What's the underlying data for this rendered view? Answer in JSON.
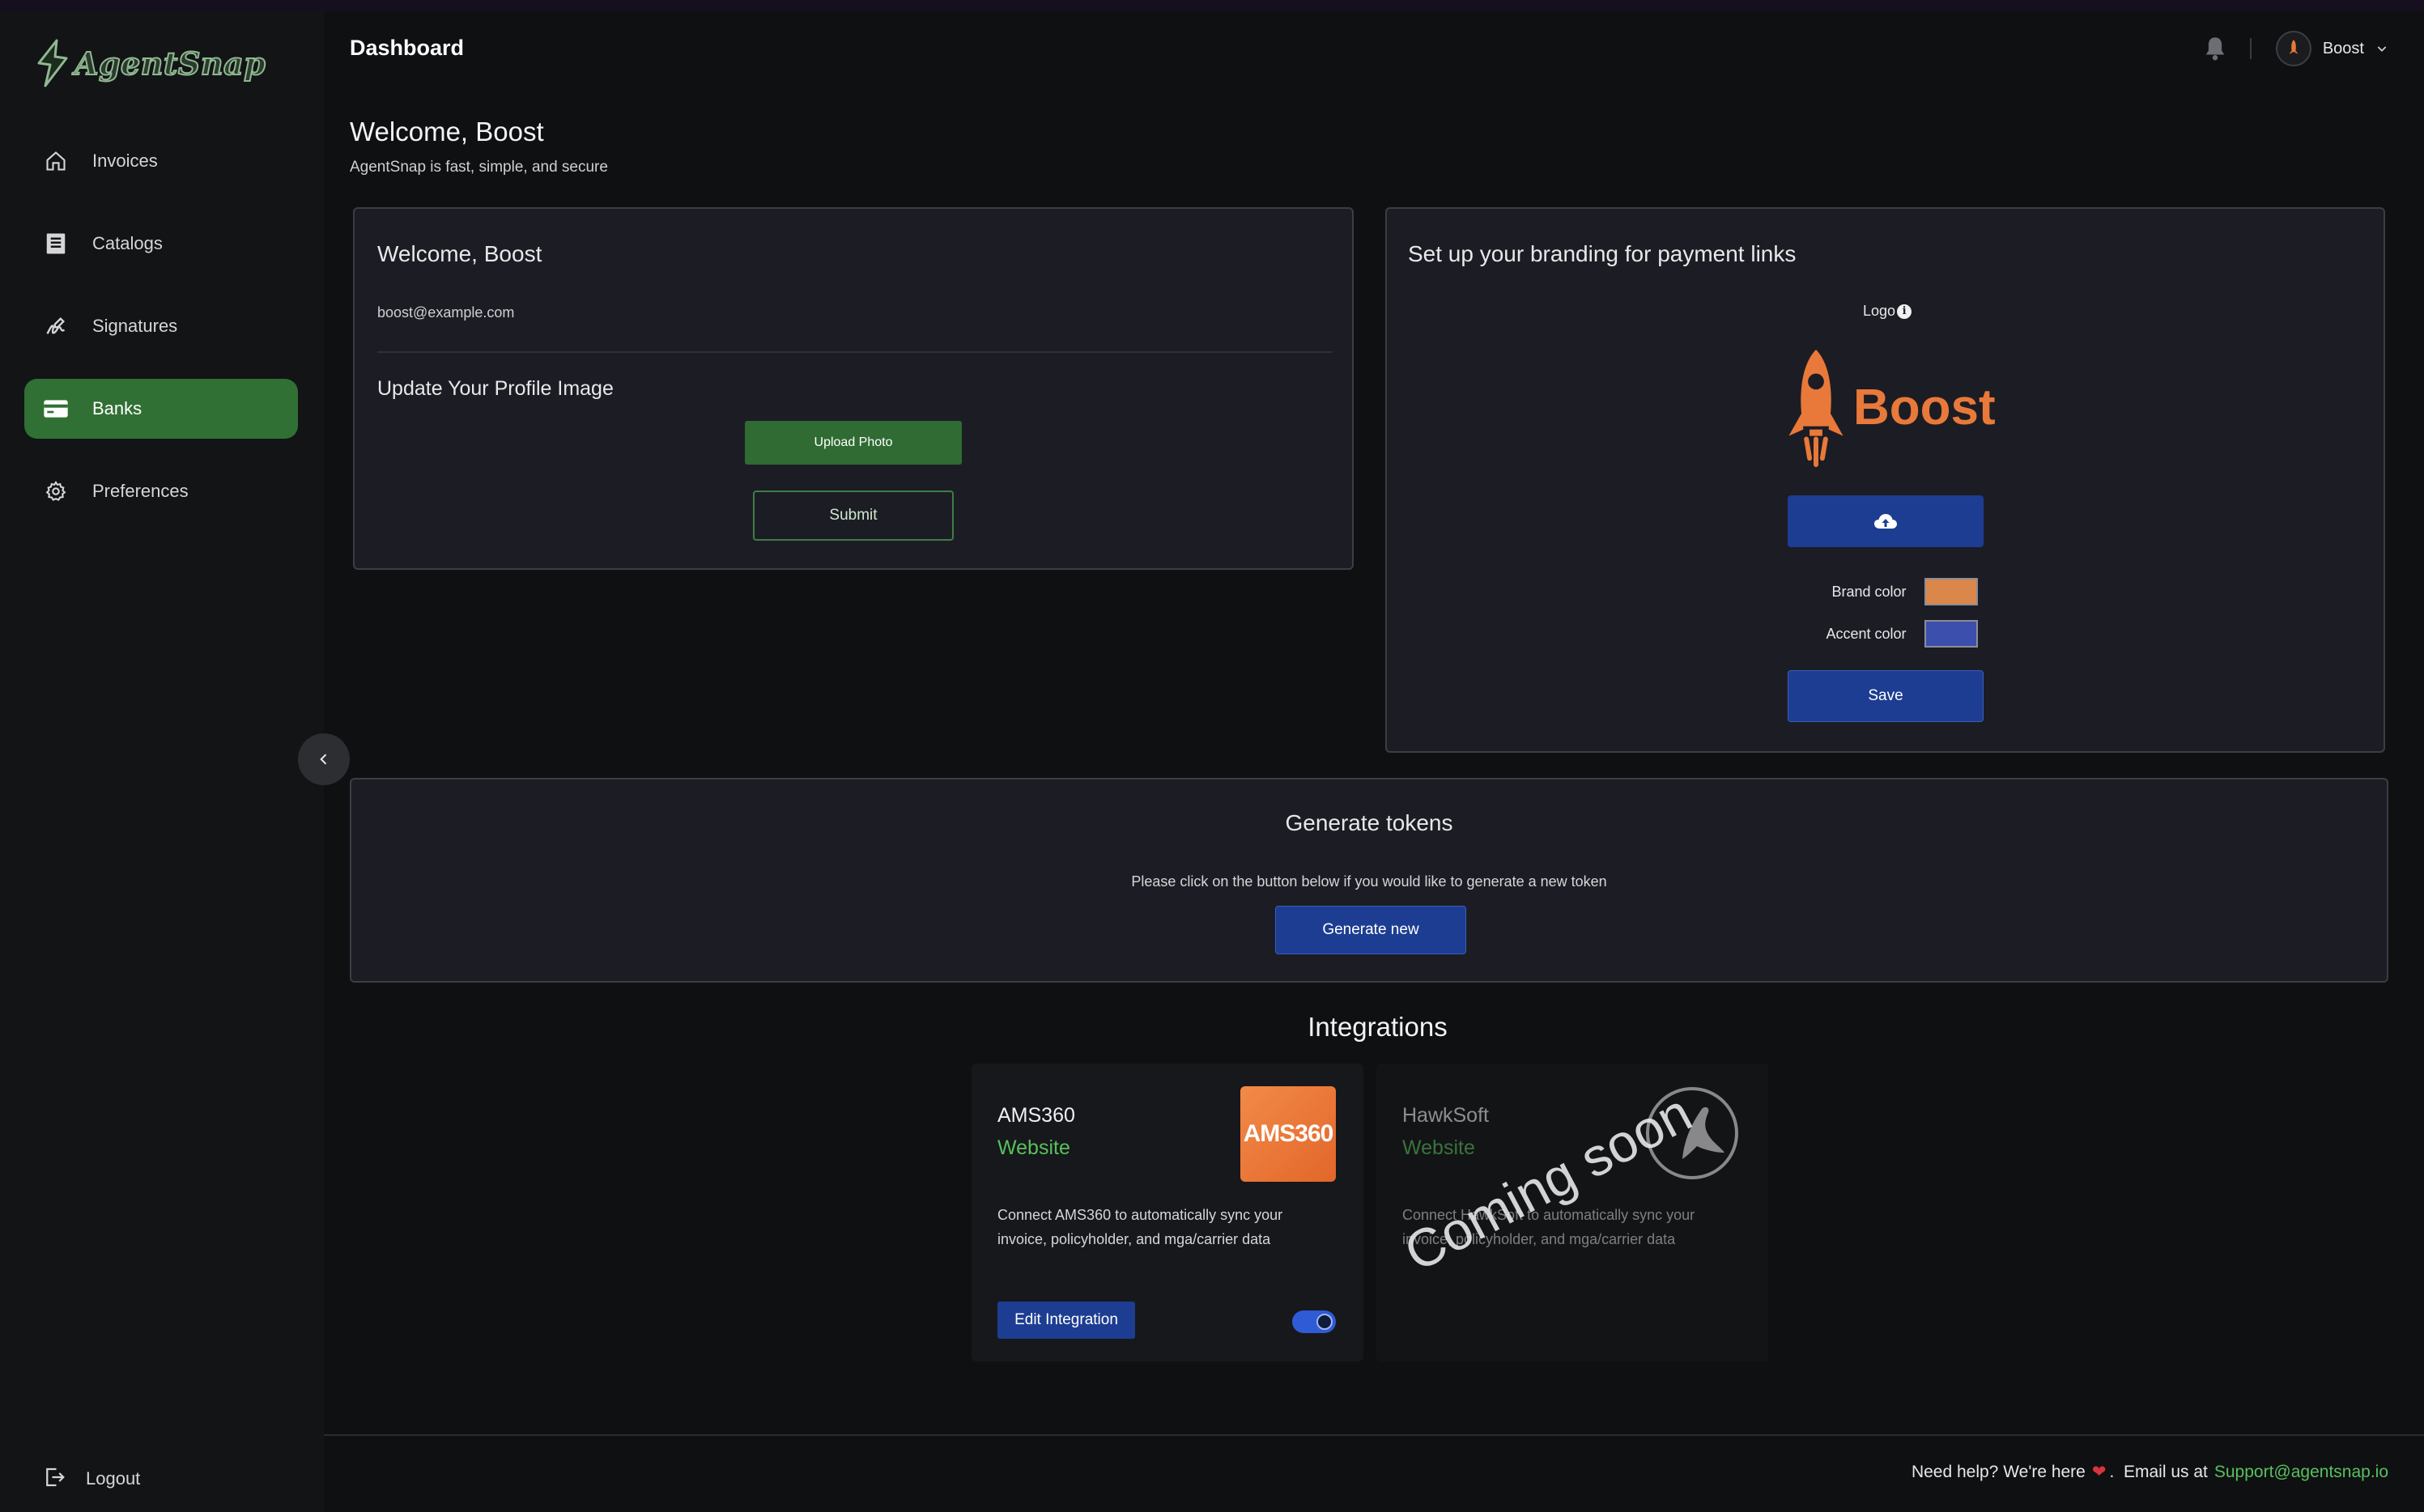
{
  "app": {
    "name": "AgentSnap"
  },
  "sidebar": {
    "items": [
      {
        "label": "Invoices",
        "icon": "home-icon"
      },
      {
        "label": "Catalogs",
        "icon": "document-list-icon"
      },
      {
        "label": "Signatures",
        "icon": "signature-icon"
      },
      {
        "label": "Banks",
        "icon": "credit-card-icon",
        "active": true
      },
      {
        "label": "Preferences",
        "icon": "gear-icon"
      }
    ],
    "logout_label": "Logout"
  },
  "header": {
    "title": "Dashboard",
    "user_name": "Boost"
  },
  "welcome": {
    "title": "Welcome, Boost",
    "subtitle": "AgentSnap is fast, simple, and secure"
  },
  "profile_card": {
    "title": "Welcome, Boost",
    "email": "boost@example.com",
    "update_heading": "Update Your Profile Image",
    "upload_label": "Upload Photo",
    "submit_label": "Submit"
  },
  "branding_card": {
    "title": "Set up your branding for payment links",
    "logo_label": "Logo",
    "brand_logo_text": "Boost",
    "brand_color_label": "Brand color",
    "brand_color": "#d9874a",
    "accent_color_label": "Accent color",
    "accent_color": "#3c4fad",
    "save_label": "Save"
  },
  "tokens_card": {
    "title": "Generate tokens",
    "description": "Please click on the button below if you would like to generate a new token",
    "button_label": "Generate new"
  },
  "integrations": {
    "title": "Integrations",
    "items": [
      {
        "name": "AMS360",
        "link_label": "Website",
        "logo_text": "AMS360",
        "description": "Connect AMS360 to automatically sync your invoice, policyholder, and mga/carrier data",
        "edit_label": "Edit Integration",
        "enabled": true
      },
      {
        "name": "HawkSoft",
        "link_label": "Website",
        "description": "Connect HawkSoft to automatically sync your invoice, policyholder, and mga/carrier data",
        "overlay": "Coming soon"
      }
    ]
  },
  "footer": {
    "help_text": "Need help? We're here",
    "email_prefix": "Email us at",
    "email": "Support@agentsnap.io"
  },
  "colors": {
    "primary_green": "#317034",
    "primary_blue": "#1d3d92",
    "link_green": "#58c05e",
    "brand_orange": "#e9793a"
  }
}
